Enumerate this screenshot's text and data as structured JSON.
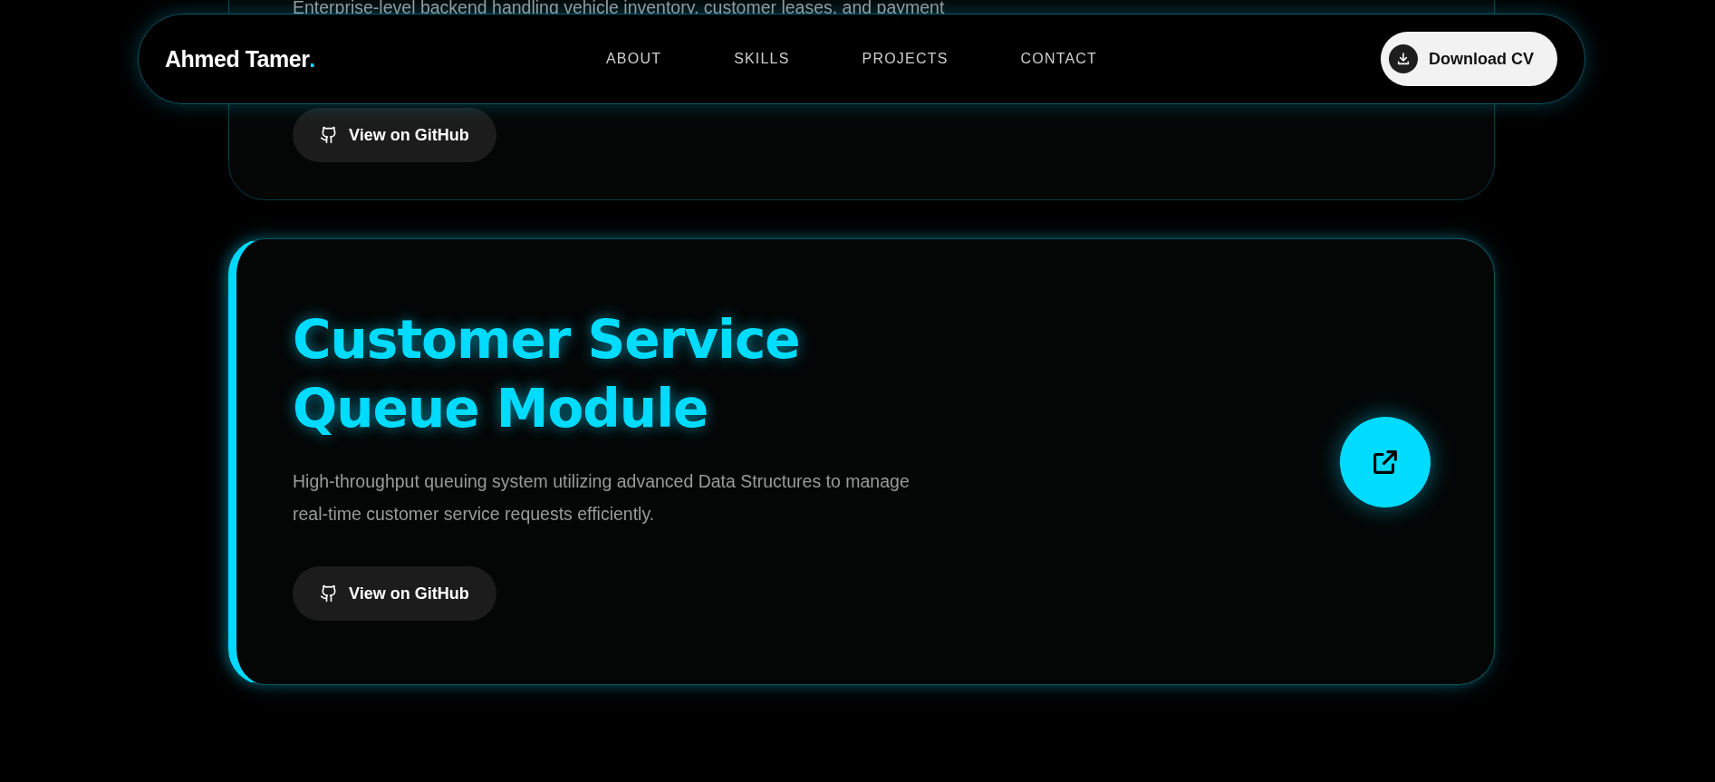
{
  "nav": {
    "brand": "Ahmed Tamer",
    "brand_mark": ".",
    "links": [
      {
        "label": "ABOUT"
      },
      {
        "label": "SKILLS"
      },
      {
        "label": "PROJECTS"
      },
      {
        "label": "CONTACT"
      }
    ],
    "cta": "Download CV"
  },
  "projects": [
    {
      "highlighted": false,
      "description": [
        "Enterprise-level backend handling vehicle inventory, customer leases, and payment"
      ],
      "link": "View on GitHub"
    },
    {
      "highlighted": true,
      "title": "Customer Service Queue Module",
      "description": [
        "High-throughput queuing system utilizing advanced Data Structures to manage",
        "real-time customer service requests efficiently."
      ],
      "link": "View on GitHub"
    }
  ]
}
